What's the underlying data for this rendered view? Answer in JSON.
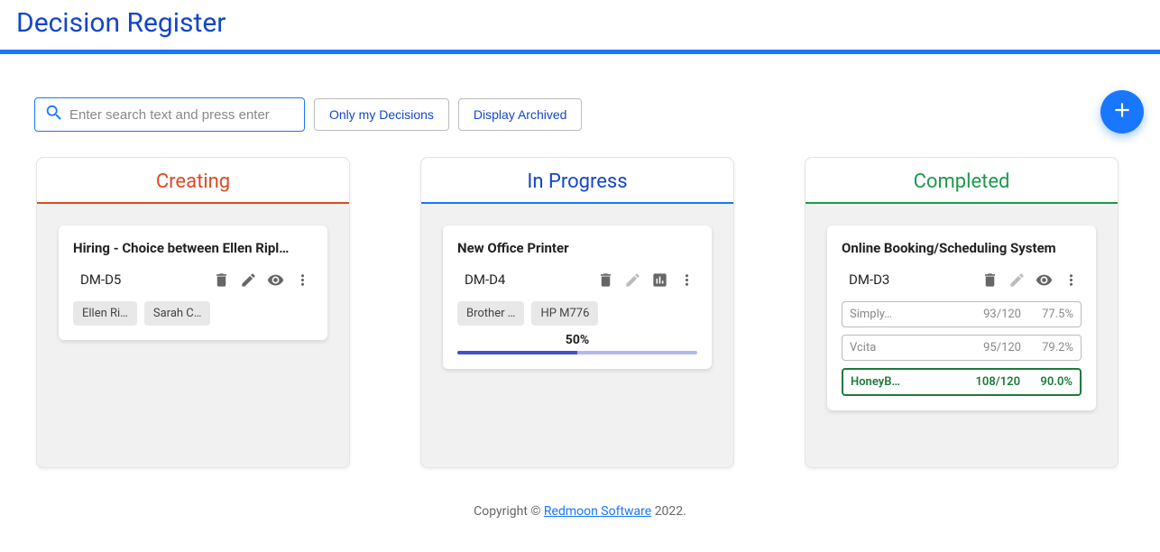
{
  "page_title": "Decision Register",
  "search_placeholder": "Enter search text and press enter",
  "btn_only_my": "Only my Decisions",
  "btn_archived": "Display Archived",
  "columns": {
    "creating": "Creating",
    "in_progress": "In Progress",
    "completed": "Completed"
  },
  "card_creating": {
    "title": "Hiring - Choice between Ellen Ripl…",
    "id": "DM-D5",
    "chip1": "Ellen Ri…",
    "chip2": "Sarah C…"
  },
  "card_inprogress": {
    "title": "New Office Printer",
    "id": "DM-D4",
    "chip1": "Brother …",
    "chip2": "HP M776",
    "progress_label": "50%",
    "progress_pct": 50
  },
  "card_completed": {
    "title": "Online Booking/Scheduling System",
    "id": "DM-D3",
    "results": [
      {
        "name": "Simply…",
        "score": "93/120",
        "pct": "77.5%",
        "winner": false
      },
      {
        "name": "Vcita",
        "score": "95/120",
        "pct": "79.2%",
        "winner": false
      },
      {
        "name": "HoneyB…",
        "score": "108/120",
        "pct": "90.0%",
        "winner": true
      }
    ]
  },
  "footer": {
    "prefix": "Copyright © ",
    "link": "Redmoon Software",
    "suffix": " 2022."
  }
}
